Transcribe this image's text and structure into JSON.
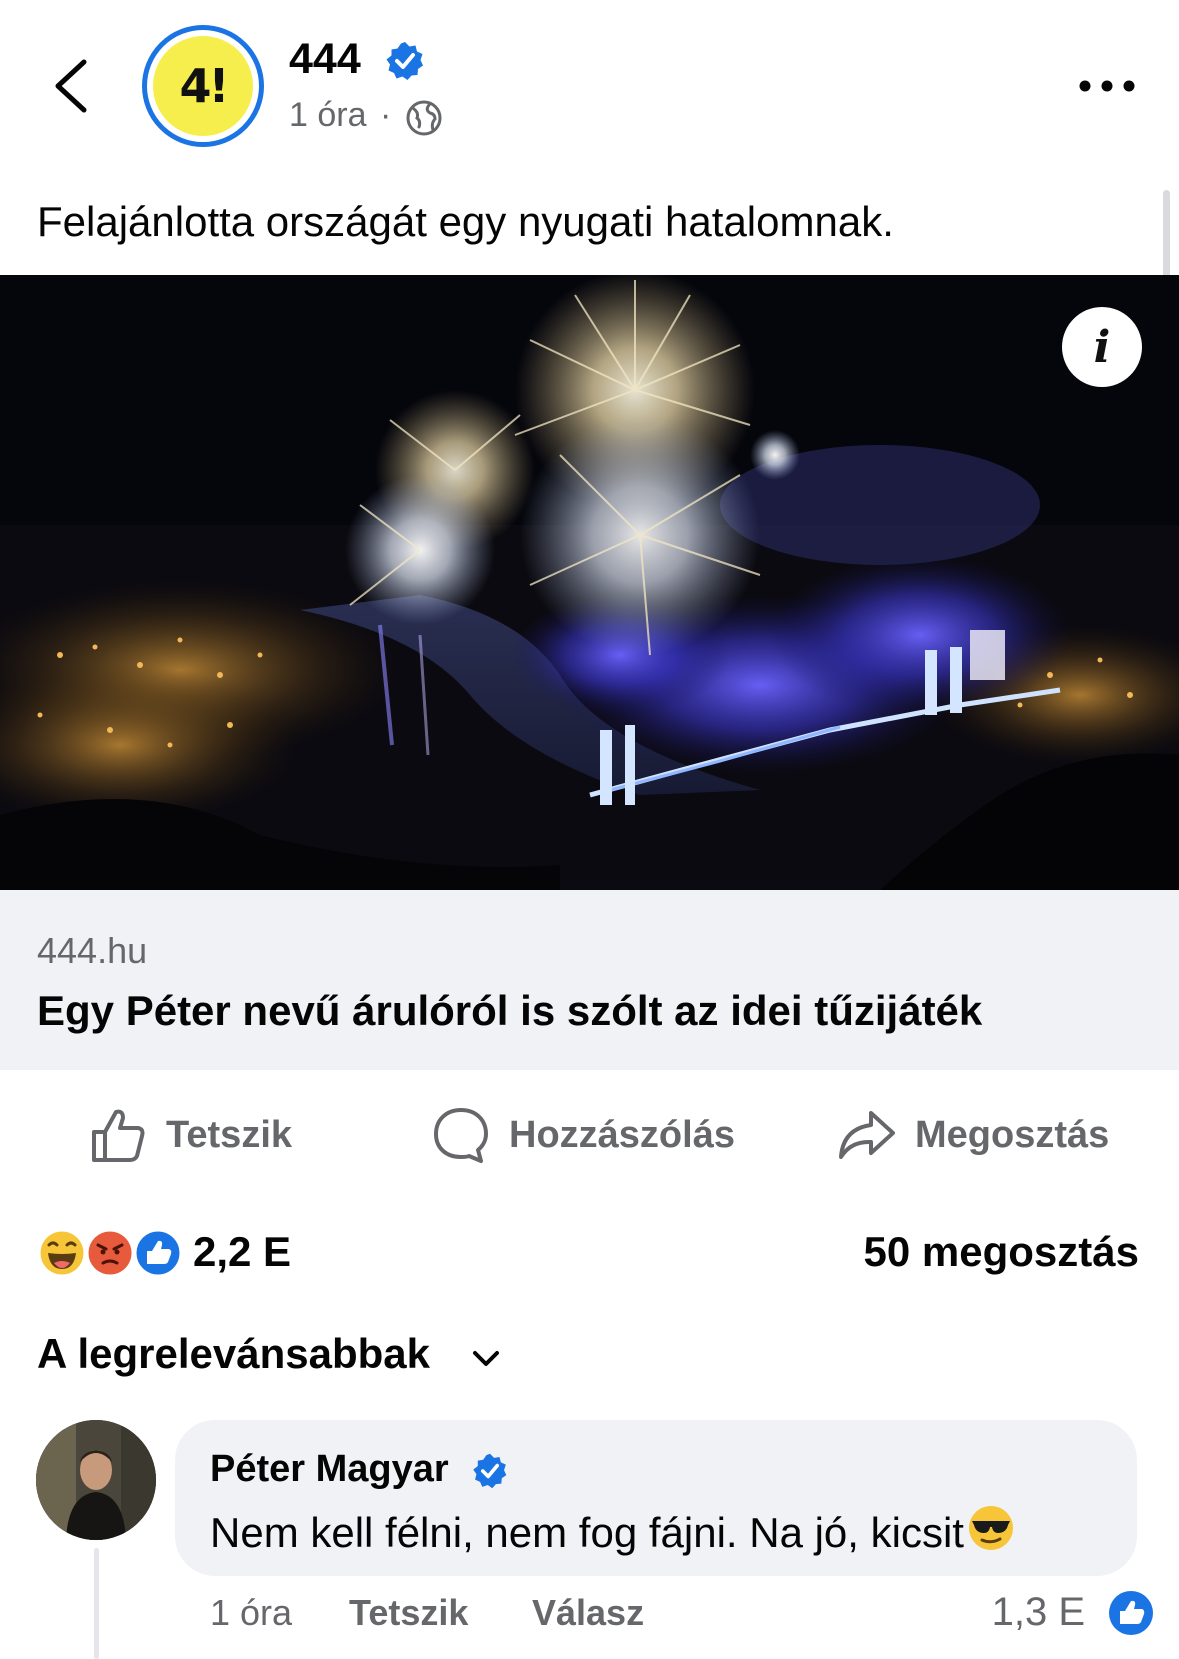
{
  "header": {
    "page_name": "444",
    "avatar_text": "4!",
    "time": "1 óra",
    "separator": "·"
  },
  "post": {
    "text": "Felajánlotta országát egy nyugati hatalomnak."
  },
  "link": {
    "domain": "444.hu",
    "title": "Egy Péter nevű árulóról is szólt az idei tűzijáték",
    "info_label": "i"
  },
  "actions": {
    "like": "Tetszik",
    "comment": "Hozzászólás",
    "share": "Megosztás"
  },
  "stats": {
    "reaction_count": "2,2 E",
    "share_count": "50 megosztás",
    "reactions": [
      "haha",
      "angry",
      "like"
    ]
  },
  "comments": {
    "sort_label": "A legrelevánsabbak",
    "items": [
      {
        "author": "Péter Magyar",
        "text": "Nem kell félni, nem fog fájni. Na jó, kicsit",
        "emoji": "sunglasses-emoji",
        "time": "1 óra",
        "like_label": "Tetszik",
        "reply_label": "Válasz",
        "reaction_count": "1,3 E"
      }
    ]
  },
  "colors": {
    "accent": "#1b74e4",
    "secondary_text": "#65676b",
    "link_box_bg": "#f0f2f5",
    "avatar_yellow": "#f6ee4c"
  }
}
